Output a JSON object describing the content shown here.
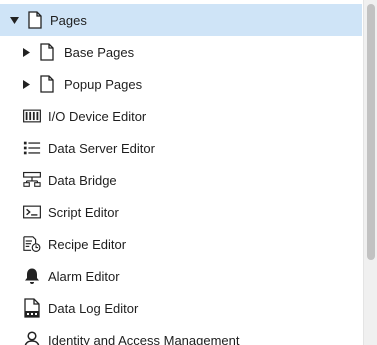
{
  "tree": {
    "pages": {
      "label": "Pages",
      "icon": "page-icon",
      "expanded": true,
      "selected": true
    },
    "base_pages": {
      "label": "Base Pages",
      "icon": "page-icon",
      "expanded": false
    },
    "popup_pages": {
      "label": "Popup Pages",
      "icon": "page-icon",
      "expanded": false
    },
    "items": [
      {
        "label": "I/O Device Editor",
        "icon": "io-device-icon"
      },
      {
        "label": "Data Server Editor",
        "icon": "data-server-icon"
      },
      {
        "label": "Data Bridge",
        "icon": "data-bridge-icon"
      },
      {
        "label": "Script Editor",
        "icon": "script-icon"
      },
      {
        "label": "Recipe Editor",
        "icon": "recipe-icon"
      },
      {
        "label": "Alarm Editor",
        "icon": "alarm-bell-icon"
      },
      {
        "label": "Data Log Editor",
        "icon": "data-log-icon"
      },
      {
        "label": "Identity and Access Management",
        "icon": "user-icon"
      }
    ]
  },
  "colors": {
    "selection": "#cfe4f7",
    "scroll_thumb": "#c2c2c2"
  }
}
